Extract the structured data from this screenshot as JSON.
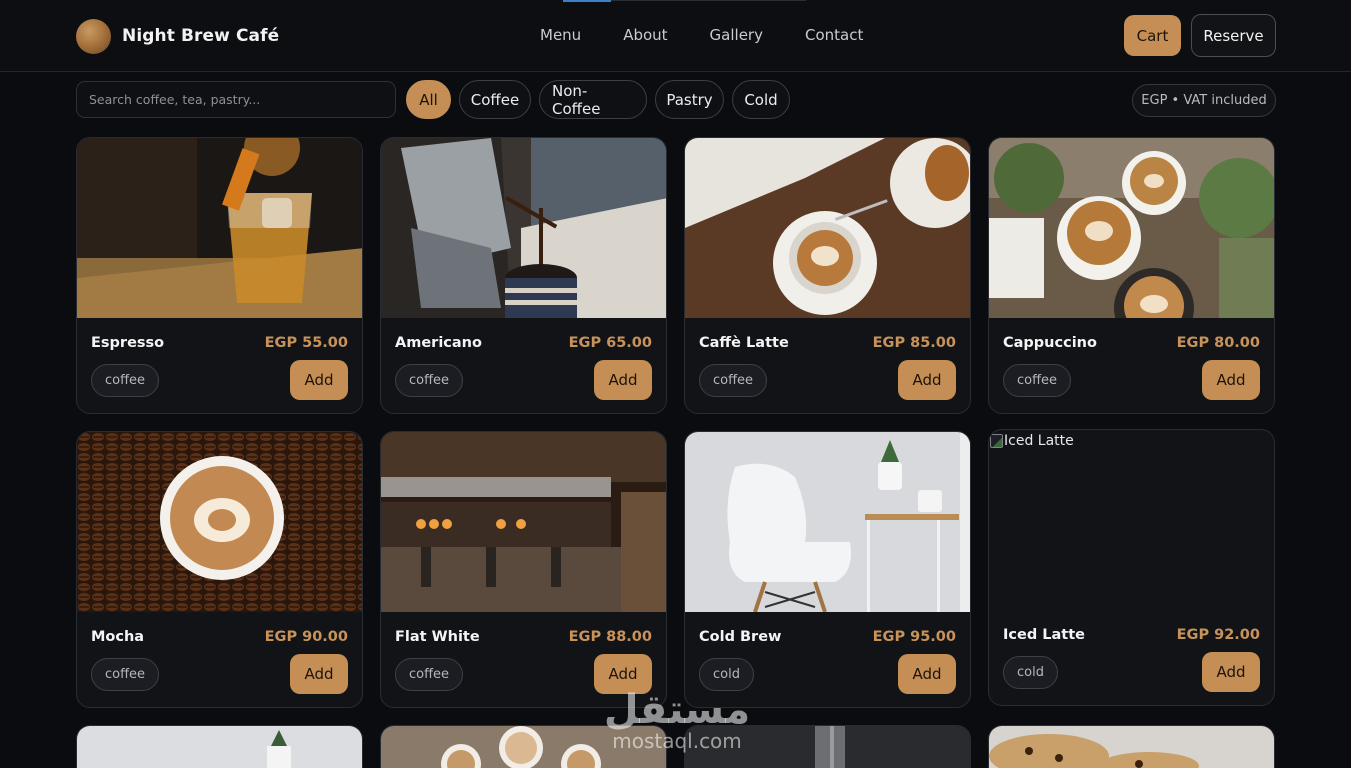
{
  "brand": {
    "name": "Night Brew Café"
  },
  "nav": {
    "items": [
      "Menu",
      "About",
      "Gallery",
      "Contact"
    ]
  },
  "actions": {
    "cart": "Cart",
    "reserve": "Reserve"
  },
  "filters": {
    "search_placeholder": "Search coffee, tea, pastry...",
    "chips": [
      "All",
      "Coffee",
      "Non-Coffee",
      "Pastry",
      "Cold"
    ],
    "active_chip": "All",
    "price_note": "EGP • VAT included"
  },
  "products": [
    {
      "name": "Espresso",
      "price": "EGP 55.00",
      "tag": "coffee",
      "add": "Add"
    },
    {
      "name": "Americano",
      "price": "EGP 65.00",
      "tag": "coffee",
      "add": "Add"
    },
    {
      "name": "Caffè Latte",
      "price": "EGP 85.00",
      "tag": "coffee",
      "add": "Add"
    },
    {
      "name": "Cappuccino",
      "price": "EGP 80.00",
      "tag": "coffee",
      "add": "Add"
    },
    {
      "name": "Mocha",
      "price": "EGP 90.00",
      "tag": "coffee",
      "add": "Add"
    },
    {
      "name": "Flat White",
      "price": "EGP 88.00",
      "tag": "coffee",
      "add": "Add"
    },
    {
      "name": "Cold Brew",
      "price": "EGP 95.00",
      "tag": "cold",
      "add": "Add"
    },
    {
      "name": "Iced Latte",
      "price": "EGP 92.00",
      "tag": "cold",
      "add": "Add",
      "image_alt": "Iced Latte"
    }
  ],
  "watermark": {
    "arabic": "مستقل",
    "latin": "mostaql.com"
  },
  "colors": {
    "accent": "#c48e55",
    "background": "#0b0c0f",
    "card": "#121317",
    "price": "#c8935a"
  }
}
